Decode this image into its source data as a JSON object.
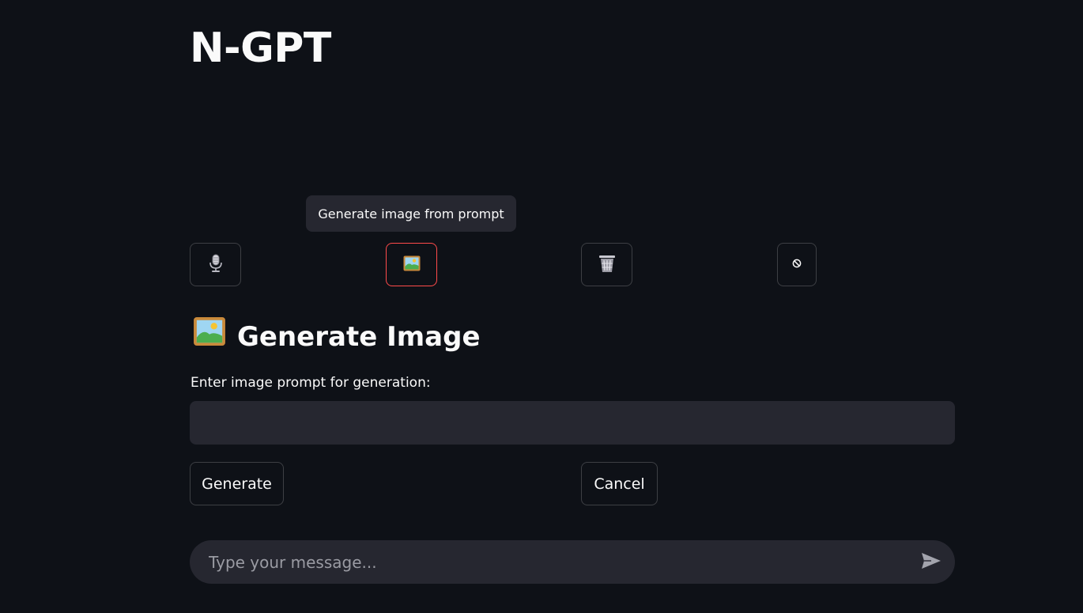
{
  "app": {
    "title": "N-GPT"
  },
  "tooltip": {
    "text": "Generate image from prompt"
  },
  "toolbar": {
    "buttons": [
      {
        "icon": "microphone-icon"
      },
      {
        "icon": "picture-icon",
        "active": true
      },
      {
        "icon": "wastebasket-icon"
      },
      {
        "icon": "no-entry-icon"
      }
    ]
  },
  "image_section": {
    "heading_text": "Generate Image",
    "heading_icon": "picture-icon",
    "field_label": "Enter image prompt for generation:",
    "prompt_value": "",
    "generate_label": "Generate",
    "cancel_label": "Cancel"
  },
  "chat": {
    "placeholder": "Type your message...",
    "send_icon": "send-icon"
  },
  "colors": {
    "background": "#0e1117",
    "surface": "#262730",
    "accent": "#ff4b4b",
    "text": "#fafafa"
  }
}
